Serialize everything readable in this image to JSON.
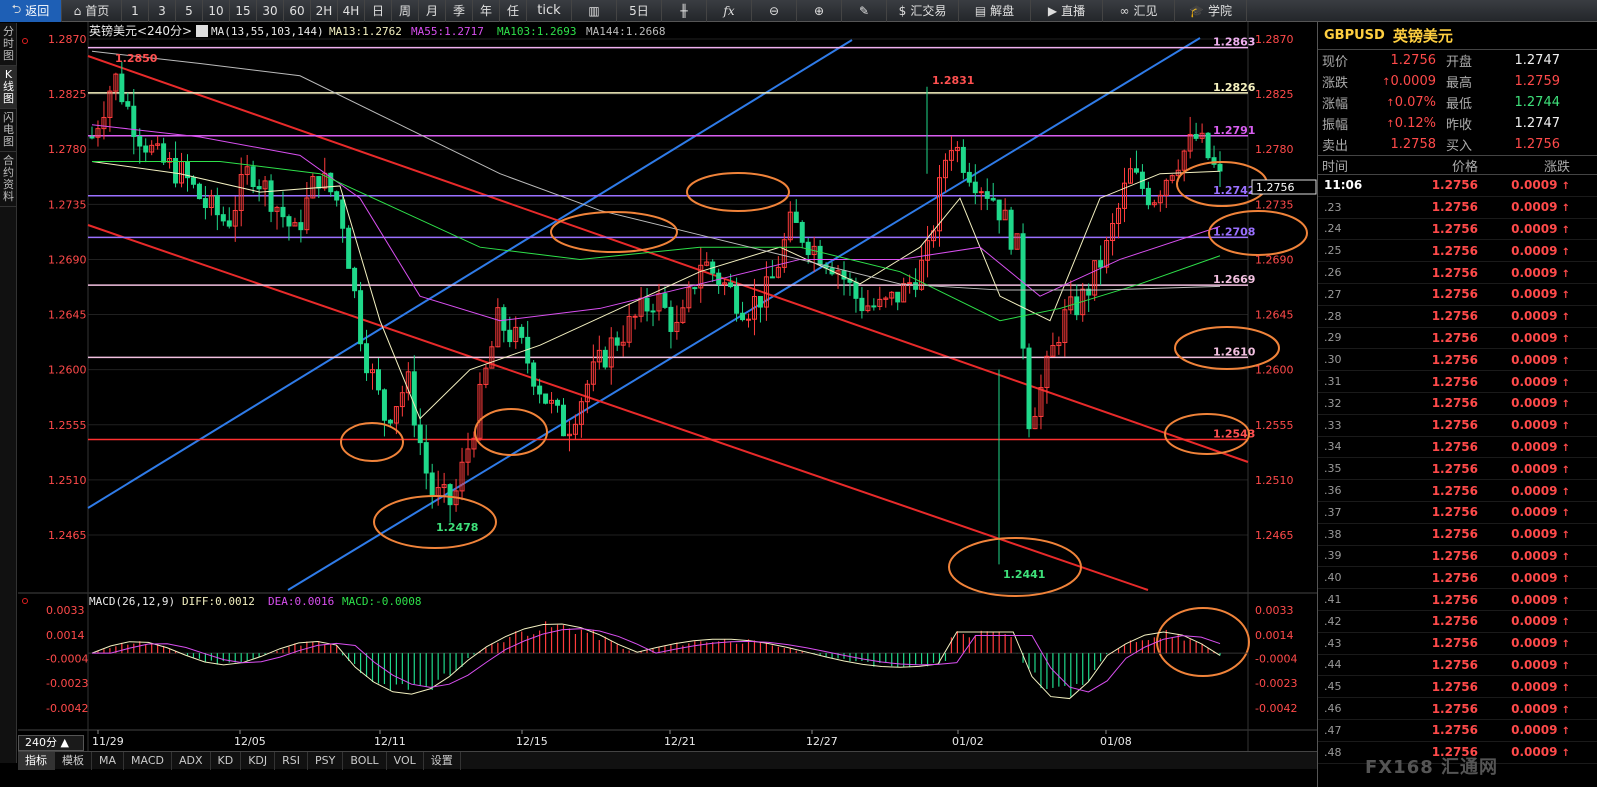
{
  "toolbar": {
    "back": "返回",
    "home": "首页",
    "periods": [
      "1",
      "3",
      "5",
      "10",
      "15",
      "30",
      "60",
      "2H",
      "4H",
      "日",
      "周",
      "月",
      "季",
      "年",
      "任",
      "tick"
    ],
    "five_day": "5日",
    "trade": "汇交易",
    "analysis": "解盘",
    "live": "直播",
    "huijian": "汇见",
    "academy": "学院"
  },
  "left_tabs": [
    "分时图",
    "K线图",
    "闪电图",
    "合约资料"
  ],
  "chart": {
    "instrument_label": "英镑美元<240分>",
    "ma_label": "MA(13,55,103,144)",
    "ma13": "MA13:1.2762",
    "ma55": "MA55:1.2717",
    "ma103": "MA103:1.2693",
    "ma144": "MA144:1.2668",
    "macd_label": "MACD(26,12,9)",
    "diff": "DIFF:0.0012",
    "dea": "DEA:0.0016",
    "macd": "MACD:-0.0008",
    "period": "240分 ▲",
    "current_price_tag": "1.2756",
    "colors": {
      "up": "#ff3c3c",
      "down": "#1fd88a",
      "channel": "#2f7be8",
      "trend": "#e82a2a",
      "circle": "#f0833a",
      "ma13": "#f3f0c0",
      "ma55": "#2ee04a",
      "ma103": "#d84ff0",
      "ma144": "#bbbbbb"
    }
  },
  "chart_data": {
    "type": "candlestick",
    "price_axis_ticks": [
      "1.2870",
      "1.2825",
      "1.2780",
      "1.2735",
      "1.2690",
      "1.2645",
      "1.2600",
      "1.2555",
      "1.2510",
      "1.2465"
    ],
    "macd_axis_ticks": [
      "0.0033",
      "0.0014",
      "-0.0004",
      "-0.0023",
      "-0.0042"
    ],
    "date_ticks": [
      "11/29",
      "12/05",
      "12/11",
      "12/15",
      "12/21",
      "12/27",
      "01/02",
      "01/08"
    ],
    "horizontal_levels": [
      {
        "label": "1.2863",
        "value": 1.2863,
        "color": "#f0b0f0"
      },
      {
        "label": "1.2826",
        "value": 1.2826,
        "color": "#f7f3c0"
      },
      {
        "label": "1.2791",
        "value": 1.2791,
        "color": "#d85ef0"
      },
      {
        "label": "1.2742",
        "value": 1.2742,
        "color": "#9a70ff"
      },
      {
        "label": "1.2708",
        "value": 1.2708,
        "color": "#9a70ff"
      },
      {
        "label": "1.2669",
        "value": 1.2669,
        "color": "#f2c0e0"
      },
      {
        "label": "1.2610",
        "value": 1.261,
        "color": "#f2c0e0"
      },
      {
        "label": "1.2543",
        "value": 1.2543,
        "color": "#ff3030"
      }
    ],
    "annotations": [
      "1.2850",
      "1.2831",
      "1.2478",
      "1.2441"
    ]
  },
  "quote": {
    "symbol": "GBPUSD",
    "name": "英镑美元",
    "rows": [
      {
        "l1": "现价",
        "v1": "1.2756",
        "c1": "red",
        "l2": "开盘",
        "v2": "1.2747",
        "c2": "white"
      },
      {
        "l1": "涨跌",
        "v1": "0.0009",
        "c1": "red",
        "l2": "最高",
        "v2": "1.2759",
        "c2": "red"
      },
      {
        "l1": "涨幅",
        "v1": "0.07%",
        "c1": "red",
        "l2": "最低",
        "v2": "1.2744",
        "c2": "green"
      },
      {
        "l1": "振幅",
        "v1": "0.12%",
        "c1": "red",
        "l2": "昨收",
        "v2": "1.2747",
        "c2": "white"
      },
      {
        "l1": "卖出",
        "v1": "1.2758",
        "c1": "red",
        "l2": "买入",
        "v2": "1.2756",
        "c2": "red"
      }
    ],
    "tick_header": {
      "time": "时间",
      "price": "价格",
      "change": "涨跌"
    },
    "ticks": [
      {
        "t": "11:06",
        "p": "1.2756",
        "c": "0.0009"
      },
      {
        "t": ".23",
        "p": "1.2756",
        "c": "0.0009"
      },
      {
        "t": ".24",
        "p": "1.2756",
        "c": "0.0009"
      },
      {
        "t": ".25",
        "p": "1.2756",
        "c": "0.0009"
      },
      {
        "t": ".26",
        "p": "1.2756",
        "c": "0.0009"
      },
      {
        "t": ".27",
        "p": "1.2756",
        "c": "0.0009"
      },
      {
        "t": ".28",
        "p": "1.2756",
        "c": "0.0009"
      },
      {
        "t": ".29",
        "p": "1.2756",
        "c": "0.0009"
      },
      {
        "t": ".30",
        "p": "1.2756",
        "c": "0.0009"
      },
      {
        "t": ".31",
        "p": "1.2756",
        "c": "0.0009"
      },
      {
        "t": ".32",
        "p": "1.2756",
        "c": "0.0009"
      },
      {
        "t": ".33",
        "p": "1.2756",
        "c": "0.0009"
      },
      {
        "t": ".34",
        "p": "1.2756",
        "c": "0.0009"
      },
      {
        "t": ".35",
        "p": "1.2756",
        "c": "0.0009"
      },
      {
        "t": ".36",
        "p": "1.2756",
        "c": "0.0009"
      },
      {
        "t": ".37",
        "p": "1.2756",
        "c": "0.0009"
      },
      {
        "t": ".38",
        "p": "1.2756",
        "c": "0.0009"
      },
      {
        "t": ".39",
        "p": "1.2756",
        "c": "0.0009"
      },
      {
        "t": ".40",
        "p": "1.2756",
        "c": "0.0009"
      },
      {
        "t": ".41",
        "p": "1.2756",
        "c": "0.0009"
      },
      {
        "t": ".42",
        "p": "1.2756",
        "c": "0.0009"
      },
      {
        "t": ".43",
        "p": "1.2756",
        "c": "0.0009"
      },
      {
        "t": ".44",
        "p": "1.2756",
        "c": "0.0009"
      },
      {
        "t": ".45",
        "p": "1.2756",
        "c": "0.0009"
      },
      {
        "t": ".46",
        "p": "1.2756",
        "c": "0.0009"
      },
      {
        "t": ".47",
        "p": "1.2756",
        "c": "0.0009"
      },
      {
        "t": ".48",
        "p": "1.2756",
        "c": "0.0009"
      }
    ]
  },
  "bottom_tabs": [
    "指标",
    "模板",
    "MA",
    "MACD",
    "ADX",
    "KD",
    "KDJ",
    "RSI",
    "PSY",
    "BOLL",
    "VOL",
    "设置"
  ],
  "watermark": "FX168 汇通网"
}
